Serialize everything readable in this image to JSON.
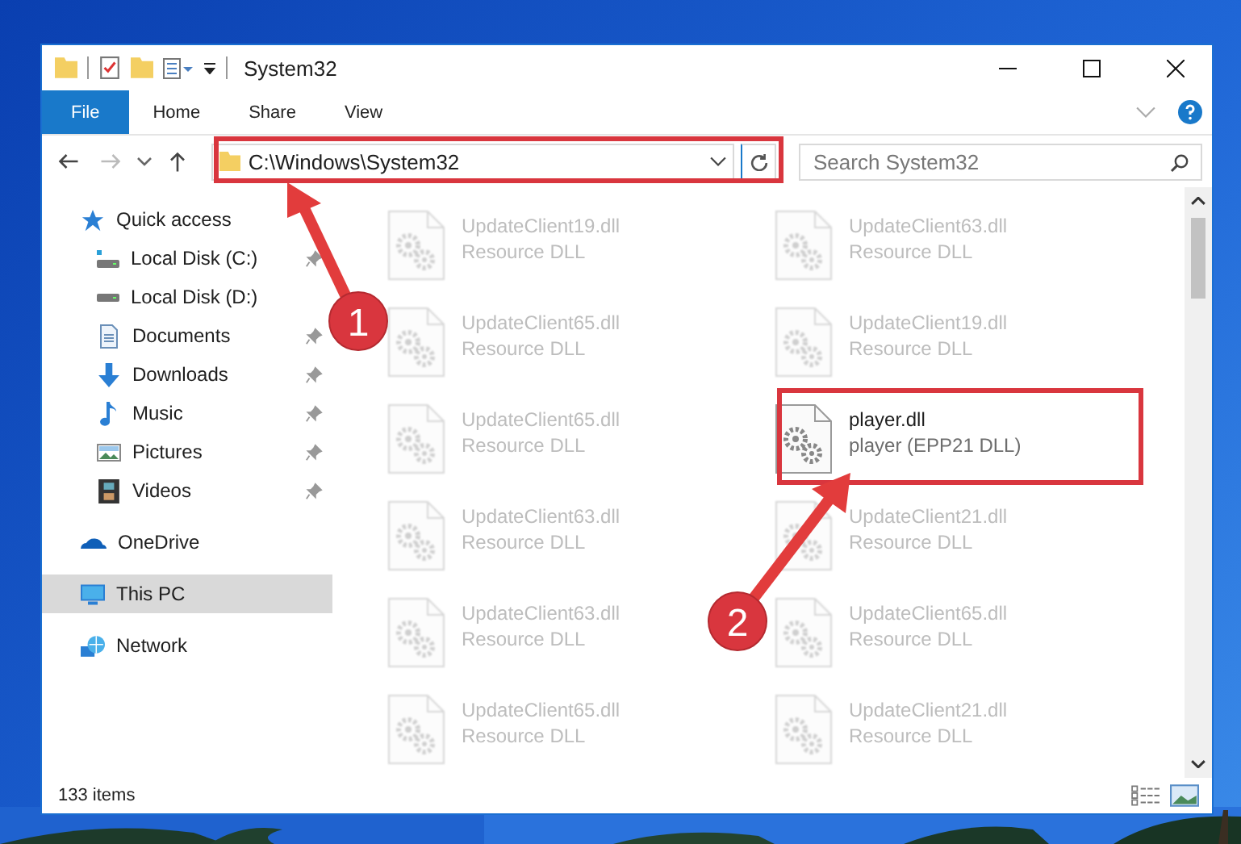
{
  "window": {
    "title": "System32"
  },
  "ribbon_tabs": [
    {
      "label": "File",
      "kind": "file"
    },
    {
      "label": "Home",
      "kind": "tab"
    },
    {
      "label": "Share",
      "kind": "tab"
    },
    {
      "label": "View",
      "kind": "tab"
    }
  ],
  "address_bar": {
    "path": "C:\\Windows\\System32"
  },
  "search": {
    "placeholder": "Search System32"
  },
  "navigation": [
    {
      "label": "Quick access",
      "kind": "quick",
      "selected": false,
      "children": [
        {
          "label": "Local Disk (C:)",
          "kind": "disk-c",
          "pinned": true,
          "selected": false
        },
        {
          "label": "Local Disk (D:)",
          "kind": "disk",
          "pinned": false,
          "selected": false
        },
        {
          "label": "Documents",
          "kind": "documents",
          "pinned": true,
          "selected": false
        },
        {
          "label": "Downloads",
          "kind": "downloads",
          "pinned": true,
          "selected": false
        },
        {
          "label": "Music",
          "kind": "music",
          "pinned": true,
          "selected": false
        },
        {
          "label": "Pictures",
          "kind": "pictures",
          "pinned": true,
          "selected": false
        },
        {
          "label": "Videos",
          "kind": "videos",
          "pinned": true,
          "selected": false
        }
      ]
    },
    {
      "label": "OneDrive",
      "kind": "onedrive",
      "selected": false
    },
    {
      "label": "This PC",
      "kind": "pc",
      "selected": true
    },
    {
      "label": "Network",
      "kind": "network",
      "selected": false
    }
  ],
  "files": [
    {
      "name": "UpdateClient19.dll",
      "type": "Resource DLL",
      "blurred": true
    },
    {
      "name": "UpdateClient63.dll",
      "type": "Resource DLL",
      "blurred": true
    },
    {
      "name": "UpdateClient65.dll",
      "type": "Resource DLL",
      "blurred": true
    },
    {
      "name": "UpdateClient19.dll",
      "type": "Resource DLL",
      "blurred": true
    },
    {
      "name": "UpdateClient65.dll",
      "type": "Resource DLL",
      "blurred": true
    },
    {
      "name": "player.dll",
      "type": "player (EPP21 DLL)",
      "blurred": false
    },
    {
      "name": "UpdateClient63.dll",
      "type": "Resource DLL",
      "blurred": true
    },
    {
      "name": "UpdateClient21.dll",
      "type": "Resource DLL",
      "blurred": true
    },
    {
      "name": "UpdateClient63.dll",
      "type": "Resource DLL",
      "blurred": true
    },
    {
      "name": "UpdateClient65.dll",
      "type": "Resource DLL",
      "blurred": true
    },
    {
      "name": "UpdateClient65.dll",
      "type": "Resource DLL",
      "blurred": true
    },
    {
      "name": "UpdateClient21.dll",
      "type": "Resource DLL",
      "blurred": true
    }
  ],
  "status_bar": {
    "item_count": "133 items"
  },
  "callouts": [
    {
      "number": "1"
    },
    {
      "number": "2"
    }
  ]
}
